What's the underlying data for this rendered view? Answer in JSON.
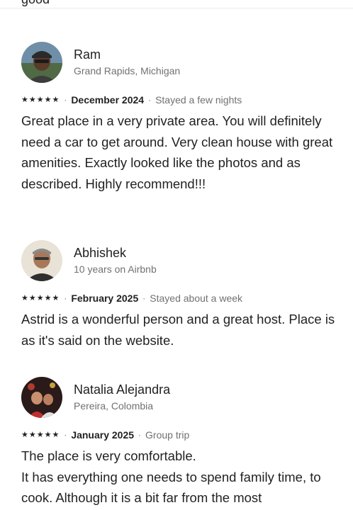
{
  "top_cut_text": "good",
  "reviews": [
    {
      "name": "Ram",
      "subtitle": "Grand Rapids, Michigan",
      "rating": 5,
      "stars": "★★★★★",
      "date": "December 2024",
      "stay": "Stayed a few nights",
      "separator": "·",
      "paragraphs": [
        "Great place in a very private area. You will definitely need a car to get around. Very clean house with great amenities. Exactly looked like the photos and as described. Highly recommend!!!"
      ]
    },
    {
      "name": "Abhishek",
      "subtitle": "10 years on Airbnb",
      "rating": 5,
      "stars": "★★★★★",
      "date": "February 2025",
      "stay": "Stayed about a week",
      "separator": "·",
      "paragraphs": [
        "Astrid is a wonderful person and a great host. Place is as it's said on the website."
      ]
    },
    {
      "name": "Natalia Alejandra",
      "subtitle": "Pereira, Colombia",
      "rating": 5,
      "stars": "★★★★★",
      "date": "January 2025",
      "stay": "Group trip",
      "separator": "·",
      "paragraphs": [
        "The place is very comfortable.",
        "It has everything one needs to spend family time, to cook. Although it is a bit far from the most"
      ]
    }
  ],
  "colors": {
    "text": "#222222",
    "muted": "#717171",
    "divider": "#ebebeb"
  }
}
